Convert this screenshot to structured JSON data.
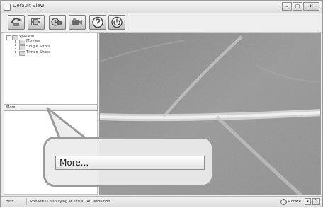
{
  "window": {
    "title": "Default View",
    "controls": {
      "minimize": "–",
      "maximize": "□",
      "close": "✕"
    }
  },
  "toolbar": {
    "buttons": [
      {
        "icon": "camera-capture-icon"
      },
      {
        "icon": "film-clip-icon"
      },
      {
        "icon": "timer-camera-icon"
      },
      {
        "icon": "video-camera-icon"
      },
      {
        "icon": "help-icon"
      },
      {
        "icon": "power-icon"
      }
    ]
  },
  "tree": {
    "root": "xplview",
    "children": [
      "Movies",
      "Single Shots",
      "Timed Shots"
    ],
    "expander": "−"
  },
  "more_label": "More...",
  "callout": {
    "label": "More..."
  },
  "status": {
    "hint_label": "Hint:",
    "message": "Preview is displaying at 320 X 240 resolution",
    "rotate_label": "Rotate",
    "dropdown_glyph": "▾"
  }
}
